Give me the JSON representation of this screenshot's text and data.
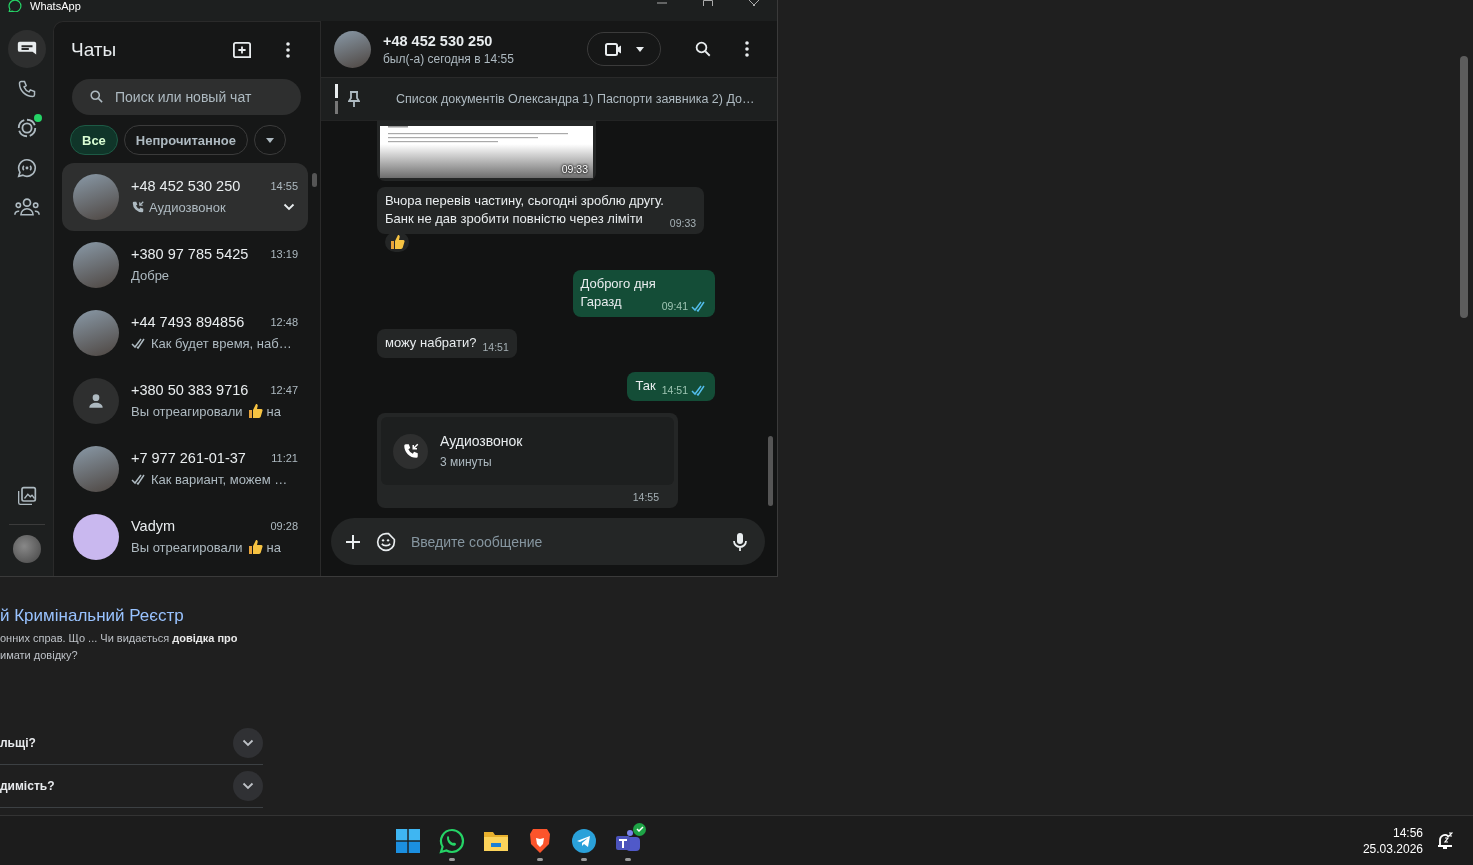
{
  "window": {
    "title": "WhatsApp"
  },
  "nav": {
    "top": [
      {
        "kind": "chats",
        "selected": true,
        "unread": false
      },
      {
        "kind": "calls",
        "selected": false,
        "unread": false
      },
      {
        "kind": "status",
        "selected": false,
        "unread": true
      },
      {
        "kind": "channels",
        "selected": false,
        "unread": false
      },
      {
        "kind": "communities",
        "selected": false,
        "unread": false
      }
    ],
    "bottom": [
      {
        "kind": "media"
      },
      {
        "kind": "profile"
      }
    ]
  },
  "chat_list": {
    "title": "Чаты",
    "search": {
      "placeholder": "Поиск или новый чат"
    },
    "filters": [
      {
        "label": "Все",
        "selected": true
      },
      {
        "label": "Непрочитанное",
        "selected": false
      }
    ],
    "chats": [
      {
        "avatar": {
          "kind": "photo"
        },
        "name": "+48 452 530 250",
        "time": "14:55",
        "preview_icon": {
          "kind": "call"
        },
        "preview": "Аудиозвонок",
        "reacted": false,
        "selected": true
      },
      {
        "avatar": {
          "kind": "photo"
        },
        "name": "+380 97 785 5425",
        "time": "13:19",
        "preview": "Добре",
        "reacted": false,
        "selected": false
      },
      {
        "avatar": {
          "kind": "photo"
        },
        "name": "+44 7493 894856",
        "time": "12:48",
        "preview_icon": {
          "kind": "ticks"
        },
        "preview": "Как будет время, наб…",
        "reacted": false,
        "selected": false
      },
      {
        "avatar": {
          "kind": "default"
        },
        "name": "+380 50 383 9716",
        "time": "12:47",
        "preview": "Вы отреагировали",
        "reacted": true,
        "preview_after": "на",
        "selected": false
      },
      {
        "avatar": {
          "kind": "photo"
        },
        "name": "+7 977 261-01-37",
        "time": "11:21",
        "preview_icon": {
          "kind": "ticks"
        },
        "preview": "Как вариант, можем …",
        "reacted": false,
        "selected": false
      },
      {
        "avatar": {
          "kind": "cartoon"
        },
        "name": "Vadym",
        "time": "09:28",
        "preview": "Вы отреагировали",
        "reacted": true,
        "preview_after": "на",
        "selected": false
      }
    ]
  },
  "chat": {
    "name": "+48 452 530 250",
    "last_seen": "был(-а) сегодня в 14:55",
    "pinned": "Список документів Олександра 1) Паспорти заявника 2) До…",
    "messages": [
      {
        "kind": "image",
        "outgoing": false,
        "time": "09:33",
        "reaction": false
      },
      {
        "kind": "text",
        "outgoing": false,
        "text": "Вчора перевів частину, сьогодні зроблю другу.\nБанк не дав зробити повністю через ліміти",
        "time": "09:33",
        "reaction": true
      },
      {
        "kind": "text",
        "outgoing": true,
        "text": "Доброго дня\nГаразд",
        "time": "09:41",
        "read": true,
        "reaction": false
      },
      {
        "kind": "text",
        "outgoing": false,
        "text": "можу набрати?",
        "time": "14:51",
        "reaction": false
      },
      {
        "kind": "text",
        "outgoing": true,
        "text": "Так",
        "time": "14:51",
        "read": true,
        "reaction": false
      },
      {
        "kind": "call",
        "outgoing": false,
        "title": "Аудиозвонок",
        "duration": "3 минуты",
        "time": "14:55",
        "reaction": false
      }
    ],
    "composer": {
      "placeholder": "Введите сообщение"
    }
  },
  "web_page": {
    "result_title": "й Кримінальний Реєстр",
    "snippet": "онних справ. Що ... Чи видається **довідка про**\nимати довідку?",
    "questions": [
      {
        "text": "льщі?",
        "expanded": false
      },
      {
        "text": "димість?",
        "expanded": false
      }
    ]
  },
  "taskbar": {
    "apps": [
      {
        "kind": "start",
        "running": false,
        "badge": false
      },
      {
        "kind": "whatsapp",
        "running": true,
        "badge": false
      },
      {
        "kind": "explorer",
        "running": false,
        "badge": false
      },
      {
        "kind": "brave",
        "running": true,
        "badge": false
      },
      {
        "kind": "telegram",
        "running": true,
        "badge": false
      },
      {
        "kind": "teams",
        "running": true,
        "badge": true
      }
    ],
    "time": "14:56",
    "date": "25.03.2026"
  }
}
